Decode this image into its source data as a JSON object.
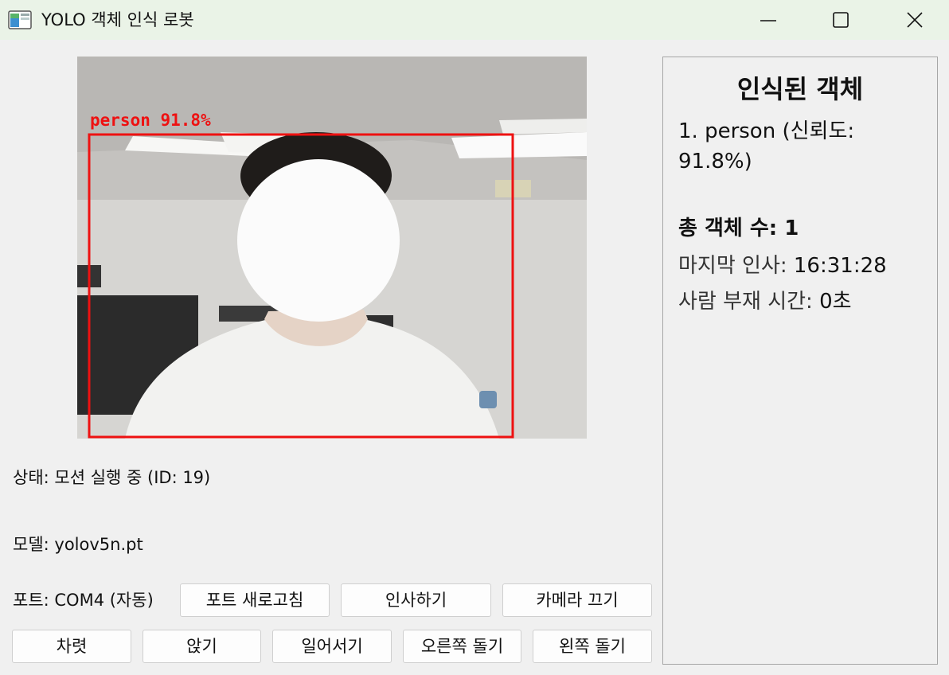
{
  "window": {
    "title": "YOLO 객체 인식 로봇"
  },
  "camera": {
    "detections": [
      {
        "label": "person 91.8%",
        "color": "#ee1111"
      }
    ]
  },
  "status": {
    "text": "상태: 모션 실행 중 (ID: 19)"
  },
  "model": {
    "text": "모델: yolov5n.pt"
  },
  "port": {
    "text": "포트: COM4 (자동)"
  },
  "buttons": {
    "refresh_port": "포트 새로고침",
    "greet": "인사하기",
    "camera_off": "카메라 끄기",
    "attention": "차렷",
    "sit": "앉기",
    "stand_up": "일어서기",
    "turn_right": "오른쪽 돌기",
    "turn_left": "왼쪽 돌기"
  },
  "panel": {
    "title": "인식된 객체",
    "objects": [
      "1. person (신뢰도: 91.8%)"
    ],
    "total_label": "총 객체 수: ",
    "total_value": "1",
    "last_greet_label": "마지막 인사: ",
    "last_greet_value": "16:31:28",
    "absence_label": "사람 부재 시간: ",
    "absence_value": "0초"
  }
}
